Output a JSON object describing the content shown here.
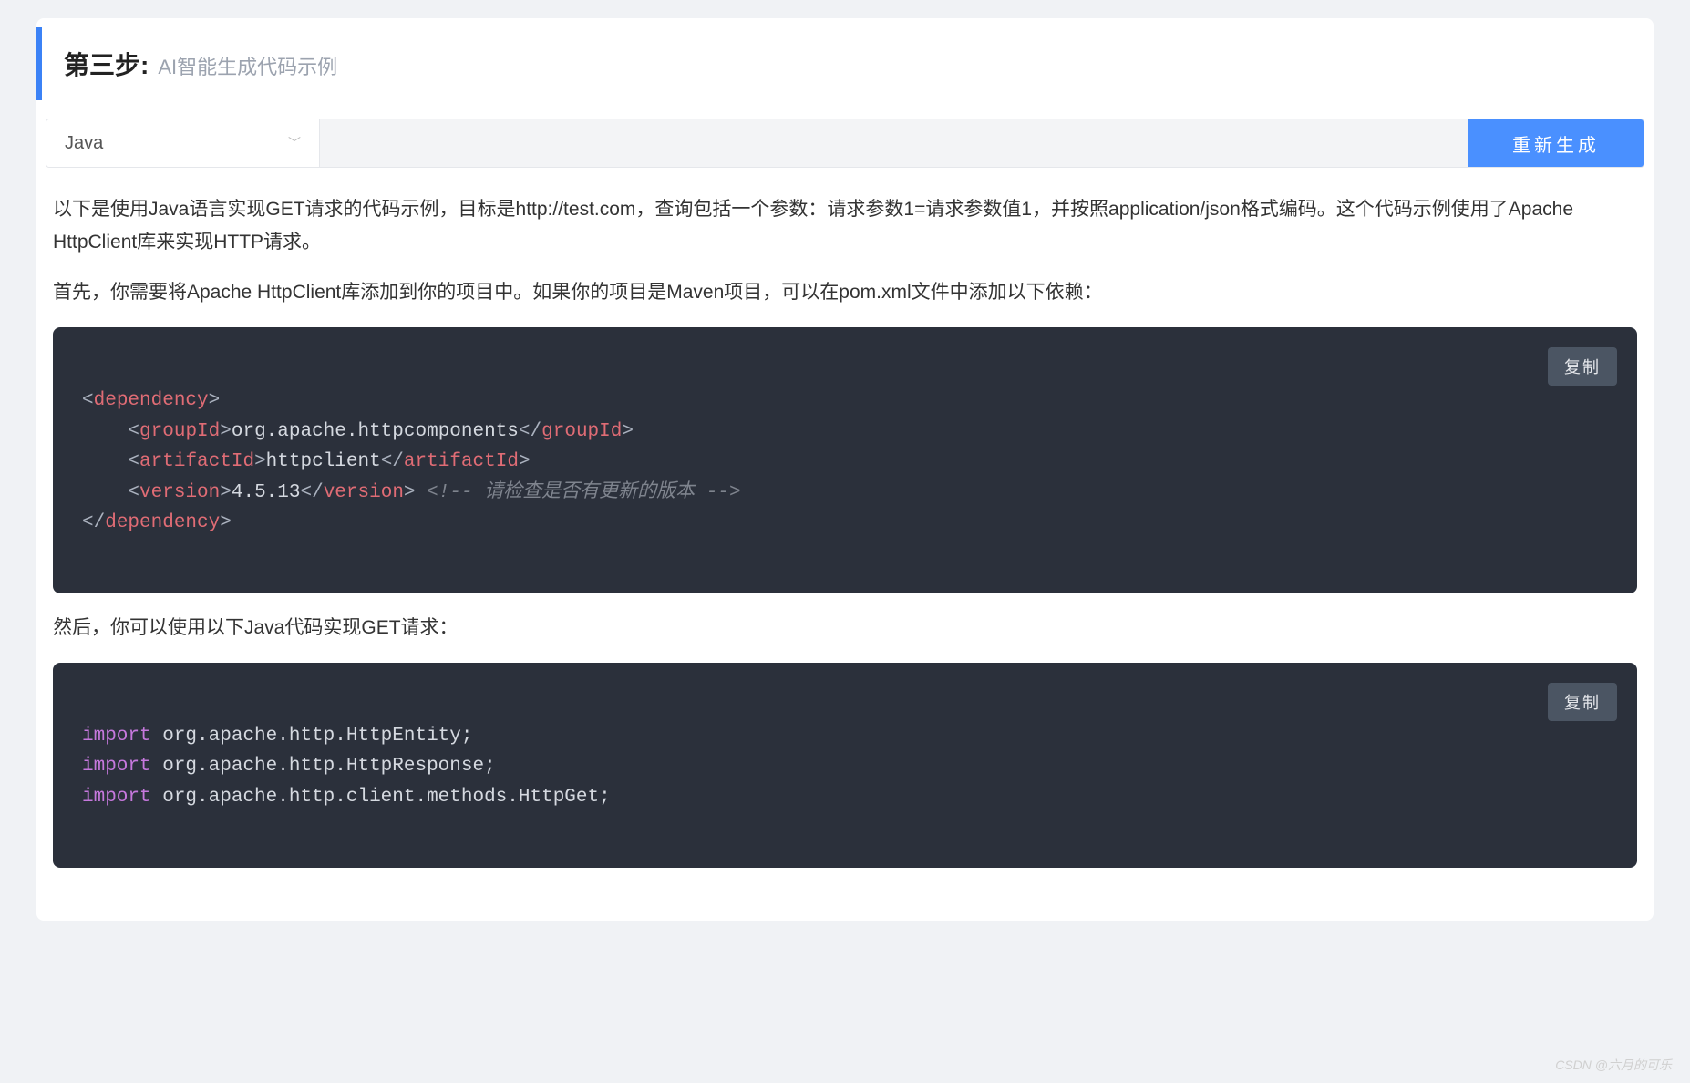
{
  "header": {
    "step_title": "第三步:",
    "step_subtitle": "AI智能生成代码示例"
  },
  "toolbar": {
    "language_selected": "Java",
    "regenerate_label": "重新生成"
  },
  "content": {
    "intro1": "以下是使用Java语言实现GET请求的代码示例，目标是http://test.com，查询包括一个参数：请求参数1=请求参数值1，并按照application/json格式编码。这个代码示例使用了Apache HttpClient库来实现HTTP请求。",
    "intro2": "首先，你需要将Apache HttpClient库添加到你的项目中。如果你的项目是Maven项目，可以在pom.xml文件中添加以下依赖：",
    "intro3": "然后，你可以使用以下Java代码实现GET请求：",
    "copy_label": "复制",
    "code1": {
      "l1_open": "<",
      "l1_tag": "dependency",
      "l1_close": ">",
      "l2_open": "<",
      "l2_tag": "groupId",
      "l2_gt": ">",
      "l2_text": "org.apache.httpcomponents",
      "l2_copen": "</",
      "l2_ctag": "groupId",
      "l2_cgt": ">",
      "l3_open": "<",
      "l3_tag": "artifactId",
      "l3_gt": ">",
      "l3_text": "httpclient",
      "l3_copen": "</",
      "l3_ctag": "artifactId",
      "l3_cgt": ">",
      "l4_open": "<",
      "l4_tag": "version",
      "l4_gt": ">",
      "l4_text": "4.5.13",
      "l4_copen": "</",
      "l4_ctag": "version",
      "l4_cgt": ">",
      "l4_comment": "<!-- 请检查是否有更新的版本 -->",
      "l5_copen": "</",
      "l5_ctag": "dependency",
      "l5_cgt": ">"
    },
    "code2": {
      "kw": "import",
      "l1": " org.apache.http.HttpEntity;",
      "l2": " org.apache.http.HttpResponse;",
      "l3": " org.apache.http.client.methods.HttpGet;"
    }
  },
  "watermark": "CSDN @六月的可乐"
}
